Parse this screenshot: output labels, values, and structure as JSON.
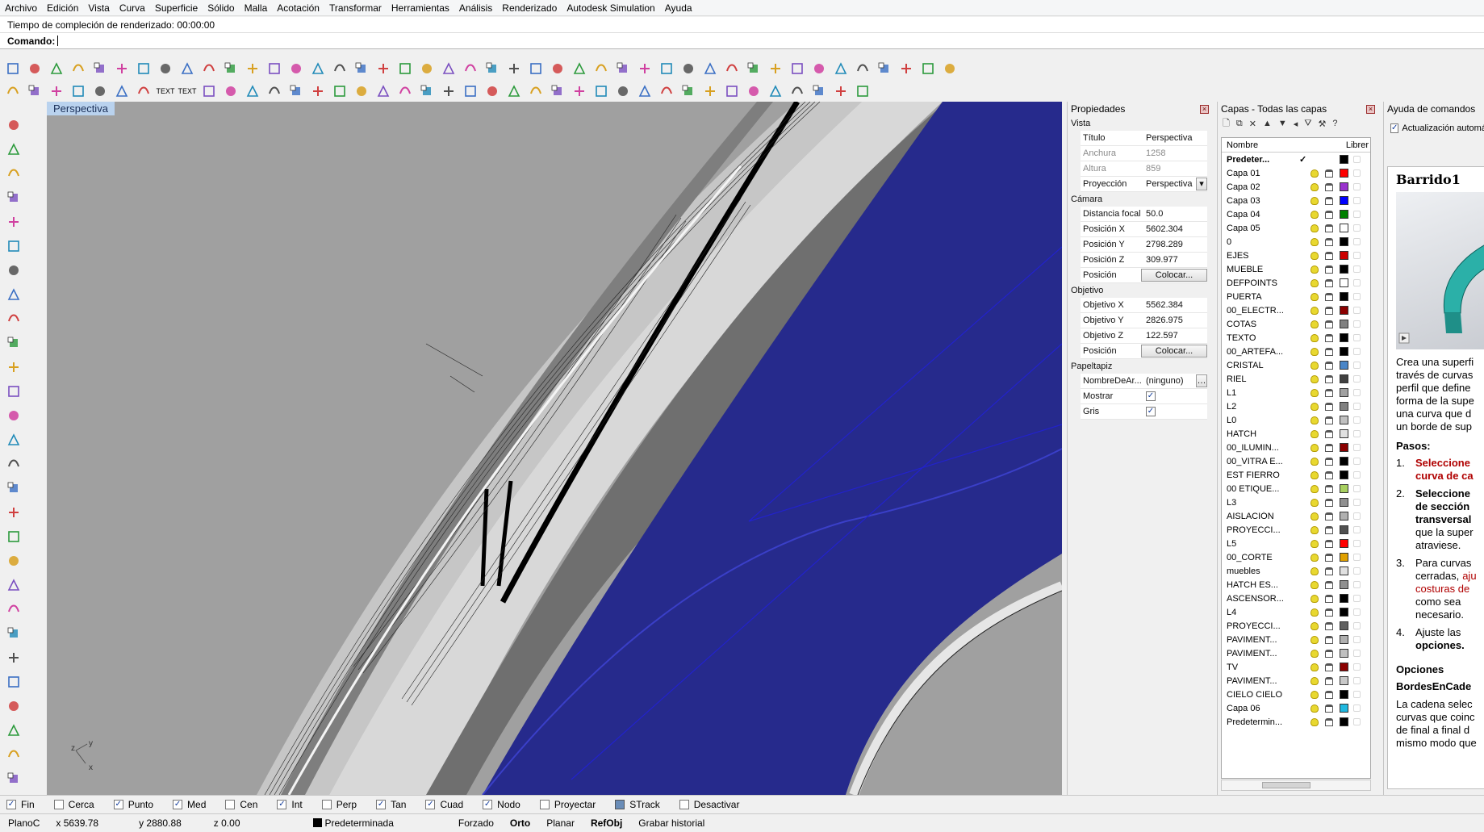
{
  "menu": [
    "Archivo",
    "Edición",
    "Vista",
    "Curva",
    "Superficie",
    "Sólido",
    "Malla",
    "Acotación",
    "Transformar",
    "Herramientas",
    "Análisis",
    "Renderizado",
    "Autodesk Simulation",
    "Ayuda"
  ],
  "history_text": "Tiempo de compleción de renderizado: 00:00:00",
  "command": {
    "label": "Comando:",
    "value": ""
  },
  "toolbar_text": {
    "text1": "TEXT",
    "text2": "TEXT"
  },
  "viewport": {
    "title": "Perspectiva",
    "axis_x": "x",
    "axis_y": "y",
    "axis_z": "z"
  },
  "properties": {
    "title": "Propiedades",
    "section_view": "Vista",
    "rows_view": [
      {
        "k": "Título",
        "v": "Perspectiva",
        "dis": false
      },
      {
        "k": "Anchura",
        "v": "1258",
        "dis": true
      },
      {
        "k": "Altura",
        "v": "859",
        "dis": true
      },
      {
        "k": "Proyección",
        "v": "Perspectiva",
        "dis": false
      }
    ],
    "section_camera": "Cámara",
    "rows_camera": [
      {
        "k": "Distancia focal",
        "v": "50.0"
      },
      {
        "k": "Posición X",
        "v": "5602.304"
      },
      {
        "k": "Posición Y",
        "v": "2798.289"
      },
      {
        "k": "Posición Z",
        "v": "309.977"
      }
    ],
    "camera_pos_label": "Posición",
    "place_button": "Colocar...",
    "section_target": "Objetivo",
    "rows_target": [
      {
        "k": "Objetivo X",
        "v": "5562.384"
      },
      {
        "k": "Objetivo Y",
        "v": "2826.975"
      },
      {
        "k": "Objetivo Z",
        "v": "122.597"
      }
    ],
    "target_pos_label": "Posición",
    "section_wallpaper": "Papeltapiz",
    "wallpaper_name_label": "NombreDeAr...",
    "wallpaper_name_value": "(ninguno)",
    "show_label": "Mostrar",
    "gray_label": "Gris"
  },
  "layers": {
    "title": "Capas - Todas las capas",
    "col_name": "Nombre",
    "col_free": "Librer",
    "items": [
      {
        "name": "Predeter...",
        "current": true,
        "color": "#000000"
      },
      {
        "name": "Capa 01",
        "color": "#ff0000"
      },
      {
        "name": "Capa 02",
        "color": "#9a32cd"
      },
      {
        "name": "Capa 03",
        "color": "#0000ff"
      },
      {
        "name": "Capa 04",
        "color": "#008000"
      },
      {
        "name": "Capa 05",
        "color": "#ffffff"
      },
      {
        "name": "0",
        "color": "#000000"
      },
      {
        "name": "EJES",
        "color": "#cc0000"
      },
      {
        "name": "MUEBLE",
        "color": "#000000"
      },
      {
        "name": "DEFPOINTS",
        "color": "#ffffff"
      },
      {
        "name": "PUERTA",
        "color": "#000000"
      },
      {
        "name": "00_ELECTR...",
        "color": "#8b0000"
      },
      {
        "name": "COTAS",
        "color": "#808080"
      },
      {
        "name": "TEXTO",
        "color": "#000000"
      },
      {
        "name": "00_ARTEFA...",
        "color": "#000000"
      },
      {
        "name": "CRISTAL",
        "color": "#4a86c8"
      },
      {
        "name": "RIEL",
        "color": "#404040"
      },
      {
        "name": "L1",
        "color": "#a0a0a0"
      },
      {
        "name": "L2",
        "color": "#808080"
      },
      {
        "name": "L0",
        "color": "#c0c0c0"
      },
      {
        "name": "HATCH",
        "color": "#e0e0e0"
      },
      {
        "name": "00_ILUMIN...",
        "color": "#8b0000"
      },
      {
        "name": "00_VITRA E...",
        "color": "#000000"
      },
      {
        "name": "EST FIERRO",
        "color": "#000000"
      },
      {
        "name": "00 ETIQUE...",
        "color": "#a8d060"
      },
      {
        "name": "L3",
        "color": "#909090"
      },
      {
        "name": "AISLACIÓN",
        "color": "#b0b0b0"
      },
      {
        "name": "PROYECCI...",
        "color": "#505050"
      },
      {
        "name": "L5",
        "color": "#ff0000"
      },
      {
        "name": "00_CORTE",
        "color": "#e0a000"
      },
      {
        "name": "muebles",
        "color": "#e0e0e0"
      },
      {
        "name": "HATCH ES...",
        "color": "#909090"
      },
      {
        "name": "ASCENSOR...",
        "color": "#000000"
      },
      {
        "name": "L4",
        "color": "#000000"
      },
      {
        "name": "PROYECCI...",
        "color": "#606060"
      },
      {
        "name": "PAVIMENT...",
        "color": "#b0b0b0"
      },
      {
        "name": "PAVIMENT...",
        "color": "#c0c0c0"
      },
      {
        "name": "TV",
        "color": "#8b0000"
      },
      {
        "name": "PAVIMENT...",
        "color": "#c8c8c8"
      },
      {
        "name": "CIELO CIELO",
        "color": "#000000"
      },
      {
        "name": "Capa 06",
        "color": "#20b8e0"
      },
      {
        "name": "Predetermin...",
        "color": "#000000"
      }
    ]
  },
  "help": {
    "title": "Ayuda de comandos",
    "auto_update": "Actualización automá",
    "heading": "Barrido1",
    "intro": [
      "Crea una superfi",
      "través de curvas",
      "perfil que define",
      "forma de la supe",
      "una curva que d",
      "un borde de sup"
    ],
    "steps_title": "Pasos:",
    "steps": [
      {
        "n": "1.",
        "lines": [
          {
            "t": "Seleccione",
            "s": "red"
          },
          {
            "t": "curva de ca",
            "s": "red"
          }
        ]
      },
      {
        "n": "2.",
        "lines": [
          {
            "t": "Seleccione",
            "s": "b"
          },
          {
            "t": "de sección",
            "s": "b"
          },
          {
            "t": "transversal",
            "s": "b"
          },
          {
            "t": "que la super",
            "s": ""
          },
          {
            "t": "atraviese.",
            "s": ""
          }
        ]
      },
      {
        "n": "3.",
        "lines": [
          {
            "t": "Para curvas",
            "s": ""
          },
          {
            "t": "cerradas,",
            "s": "",
            "extra": "aju"
          },
          {
            "t": "costuras de",
            "s": "redn"
          },
          {
            "t": "como sea",
            "s": ""
          },
          {
            "t": "necesario.",
            "s": ""
          }
        ]
      },
      {
        "n": "4.",
        "lines": [
          {
            "t": "Ajuste las",
            "s": ""
          },
          {
            "t": "opciones.",
            "s": "b"
          }
        ]
      }
    ],
    "options_title": "Opciones",
    "option_name": "BordesEnCade",
    "option_desc": [
      "La cadena selec",
      "curvas que coinc",
      "de final a final d",
      "mismo modo que"
    ]
  },
  "snaps": [
    {
      "label": "Fin",
      "on": true
    },
    {
      "label": "Cerca",
      "on": false
    },
    {
      "label": "Punto",
      "on": true
    },
    {
      "label": "Med",
      "on": true
    },
    {
      "label": "Cen",
      "on": false
    },
    {
      "label": "Int",
      "on": true
    },
    {
      "label": "Perp",
      "on": false
    },
    {
      "label": "Tan",
      "on": true
    },
    {
      "label": "Cuad",
      "on": true
    },
    {
      "label": "Nodo",
      "on": true
    },
    {
      "label": "Proyectar",
      "on": false
    },
    {
      "label": "STrack",
      "on": true,
      "square": true
    },
    {
      "label": "Desactivar",
      "on": false
    }
  ],
  "status": {
    "plane": "PlanoC",
    "x": "x 5639.78",
    "y": "y 2880.88",
    "z": "z 0.00",
    "layer": "Predeterminada",
    "forced": "Forzado",
    "ortho": "Orto",
    "planar": "Planar",
    "osnap": "RefObj",
    "history": "Grabar historial"
  },
  "colors": {
    "surface_blue": "#262a8c",
    "viewport_gray": "#a0a0a0",
    "title_bg": "#b9d2ee"
  }
}
